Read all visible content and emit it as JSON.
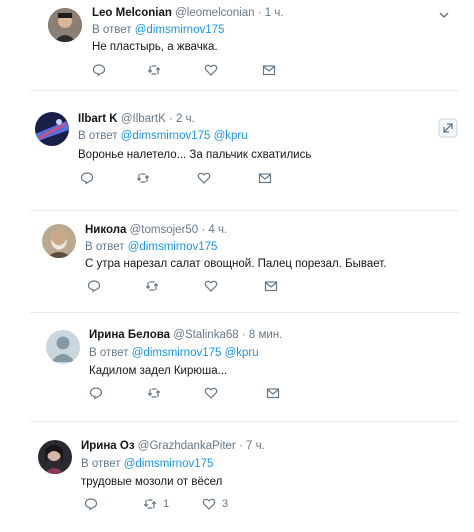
{
  "tweets": [
    {
      "name": "Leo Melconian",
      "handle": "@leomelconian",
      "time": "· 1 ч.",
      "reply_prefix": "В ответ",
      "mentions": "@dimsmirnov175",
      "text": "Не пластырь, а жвачка.",
      "replies": "",
      "retweets": "",
      "likes": ""
    },
    {
      "name": "Ilbart K",
      "handle": "@IlbartK",
      "time": "· 2 ч.",
      "reply_prefix": "В ответ",
      "mentions": "@dimsmirnov175 @kpru",
      "text": "Воронье  налетело...  За пальчик  схватились",
      "replies": "",
      "retweets": "",
      "likes": ""
    },
    {
      "name": "Никола",
      "handle": "@tomsojer50",
      "time": "· 4 ч.",
      "reply_prefix": "В ответ",
      "mentions": "@dimsmirnov175",
      "text": "С утра нарезал салат овощной. Палец порезал. Бывает.",
      "replies": "",
      "retweets": "",
      "likes": ""
    },
    {
      "name": "Ирина Белова",
      "handle": "@Stalinka68",
      "time": "· 8 мин.",
      "reply_prefix": "В ответ",
      "mentions": "@dimsmirnov175 @kpru",
      "text": "Кадилом задел Кирюша...",
      "replies": "",
      "retweets": "",
      "likes": ""
    },
    {
      "name": "Ирина Оз",
      "handle": "@GrazhdankaPiter",
      "time": "· 7 ч.",
      "reply_prefix": "В ответ",
      "mentions": "@dimsmirnov175",
      "text": "трудовые мозоли от вёсел",
      "replies": "",
      "retweets": "1",
      "likes": "3"
    }
  ],
  "icons": {
    "reply": "reply-icon",
    "retweet": "retweet-icon",
    "like": "heart-icon",
    "dm": "envelope-icon",
    "caret": "chevron-down-icon",
    "expand": "expand-icon"
  },
  "colors": {
    "link": "#1b95e0",
    "muted": "#657786",
    "text": "#14171a",
    "separator": "#e6ecf0"
  }
}
